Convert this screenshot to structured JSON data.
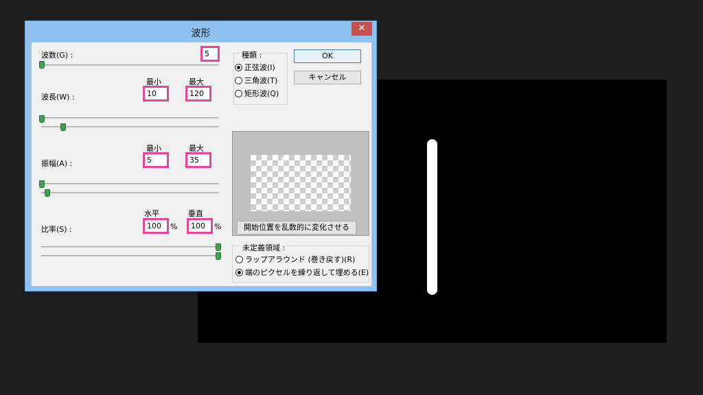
{
  "dialog": {
    "title": "波形",
    "close_icon": "close-icon"
  },
  "params": {
    "wave_count_label": "波数(G) :",
    "wave_count": "5",
    "wavelength_label": "波長(W) :",
    "wavelength_min_head": "最小",
    "wavelength_max_head": "最大",
    "wavelength_min": "10",
    "wavelength_max": "120",
    "amplitude_label": "振幅(A) :",
    "amplitude_min_head": "最小",
    "amplitude_max_head": "最大",
    "amplitude_min": "5",
    "amplitude_max": "35",
    "scale_label": "比率(S) :",
    "scale_h_head": "水平",
    "scale_v_head": "垂直",
    "scale_h": "100",
    "scale_v": "100",
    "percent": "%"
  },
  "type_group": {
    "title": "種類 :",
    "options": [
      "正弦波(I)",
      "三角波(T)",
      "矩形波(Q)"
    ],
    "selected": 0
  },
  "buttons": {
    "ok": "OK",
    "cancel": "キャンセル",
    "randomize": "開始位置を乱数的に変化させる"
  },
  "undefined_group": {
    "title": "未定義領域 :",
    "options": [
      "ラップアラウンド (巻き戻す)(R)",
      "端のピクセルを繰り返して埋める(E)"
    ],
    "selected": 1
  }
}
